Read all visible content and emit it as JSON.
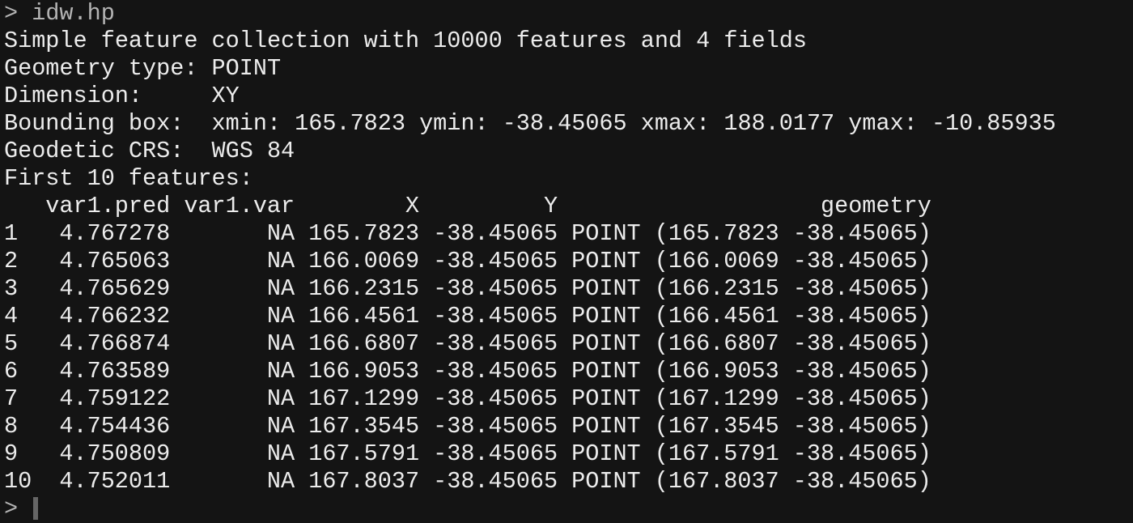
{
  "command": {
    "prompt": ">",
    "text": "idw.hp"
  },
  "info": [
    "Simple feature collection with 10000 features and 4 fields",
    "Geometry type: POINT",
    "Dimension:     XY",
    "Bounding box:  xmin: 165.7823 ymin: -38.45065 xmax: 188.0177 ymax: -10.85935",
    "Geodetic CRS:  WGS 84",
    "First 10 features:"
  ],
  "table": {
    "columns": [
      "var1.pred",
      "var1.var",
      "X",
      "Y",
      "geometry"
    ],
    "rows": [
      [
        "1",
        "4.767278",
        "NA",
        "165.7823",
        "-38.45065",
        "POINT (165.7823 -38.45065)"
      ],
      [
        "2",
        "4.765063",
        "NA",
        "166.0069",
        "-38.45065",
        "POINT (166.0069 -38.45065)"
      ],
      [
        "3",
        "4.765629",
        "NA",
        "166.2315",
        "-38.45065",
        "POINT (166.2315 -38.45065)"
      ],
      [
        "4",
        "4.766232",
        "NA",
        "166.4561",
        "-38.45065",
        "POINT (166.4561 -38.45065)"
      ],
      [
        "5",
        "4.766874",
        "NA",
        "166.6807",
        "-38.45065",
        "POINT (166.6807 -38.45065)"
      ],
      [
        "6",
        "4.763589",
        "NA",
        "166.9053",
        "-38.45065",
        "POINT (166.9053 -38.45065)"
      ],
      [
        "7",
        "4.759122",
        "NA",
        "167.1299",
        "-38.45065",
        "POINT (167.1299 -38.45065)"
      ],
      [
        "8",
        "4.754436",
        "NA",
        "167.3545",
        "-38.45065",
        "POINT (167.3545 -38.45065)"
      ],
      [
        "9",
        "4.750809",
        "NA",
        "167.5791",
        "-38.45065",
        "POINT (167.5791 -38.45065)"
      ],
      [
        "10",
        "4.752011",
        "NA",
        "167.8037",
        "-38.45065",
        "POINT (167.8037 -38.45065)"
      ]
    ]
  },
  "input_prompt": ">"
}
